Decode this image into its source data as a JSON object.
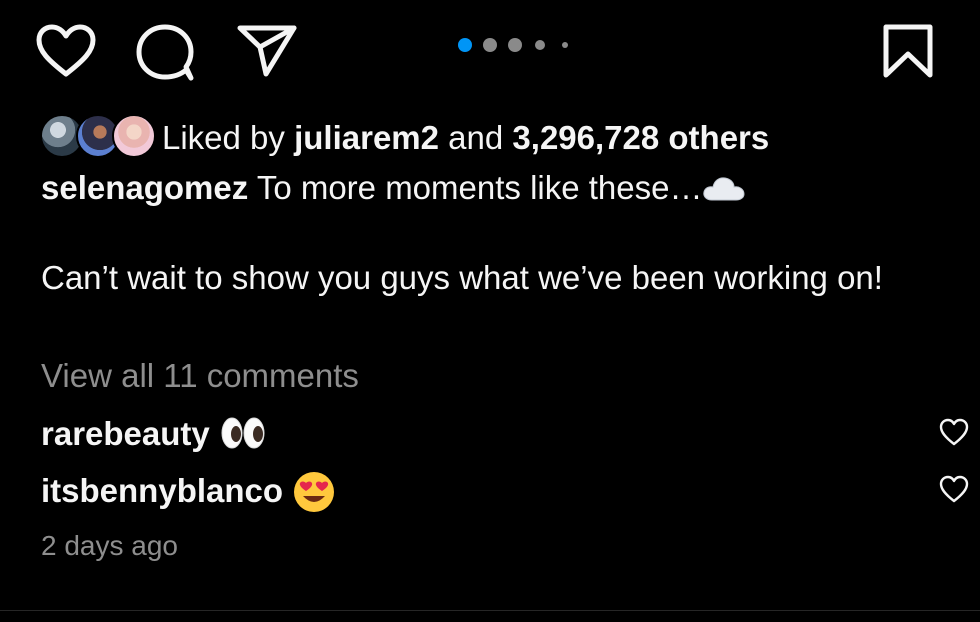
{
  "action_bar": {
    "icons": [
      "heart-icon",
      "comment-icon",
      "paper-plane-icon",
      "bookmark-icon"
    ],
    "carousel": {
      "count": 5,
      "active_index": 0
    },
    "colors": {
      "active_dot": "#0095f6",
      "inactive_dot": "#8a8a8a"
    }
  },
  "likes": {
    "prefix": "Liked by ",
    "user": "juliarem2",
    "joiner": " and ",
    "count": "3,296,728 others"
  },
  "caption": {
    "username": "selenagomez",
    "line1": " To more moments like these…",
    "line1_emoji": "cloud",
    "line2": "Can’t wait to show you guys what we’ve been working on!"
  },
  "view_all": "View all 11 comments",
  "comments": [
    {
      "username": "rarebeauty",
      "emoji": "eyes"
    },
    {
      "username": "itsbennyblanco",
      "emoji": "smiling-face-with-heart-eyes"
    }
  ],
  "timestamp": "2 days ago"
}
